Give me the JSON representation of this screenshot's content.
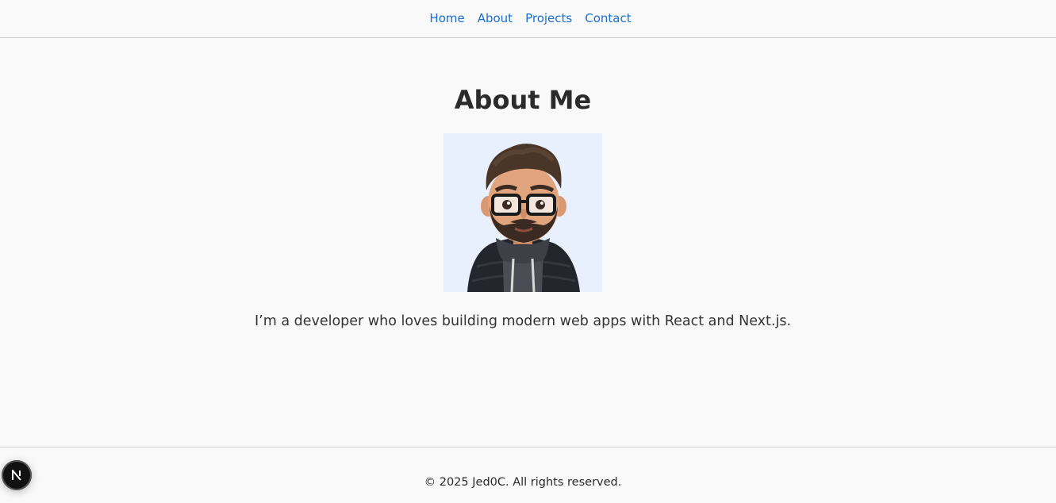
{
  "nav": {
    "items": [
      {
        "label": "Home"
      },
      {
        "label": "About"
      },
      {
        "label": "Projects"
      },
      {
        "label": "Contact"
      }
    ]
  },
  "main": {
    "title": "About Me",
    "avatar": {
      "icon": "cartoon-developer-avatar"
    },
    "intro": "I’m a developer who loves building modern web apps with React and Next.js."
  },
  "footer": {
    "copyright": "© 2025 Jed0C. All rights reserved."
  },
  "dev_badge": {
    "icon": "nextjs-logo-icon"
  },
  "colors": {
    "link": "#1a6fd1",
    "background": "#f9f9f9",
    "text": "#333333",
    "avatar_bg": "#e8f0fd",
    "badge": "#111111"
  }
}
